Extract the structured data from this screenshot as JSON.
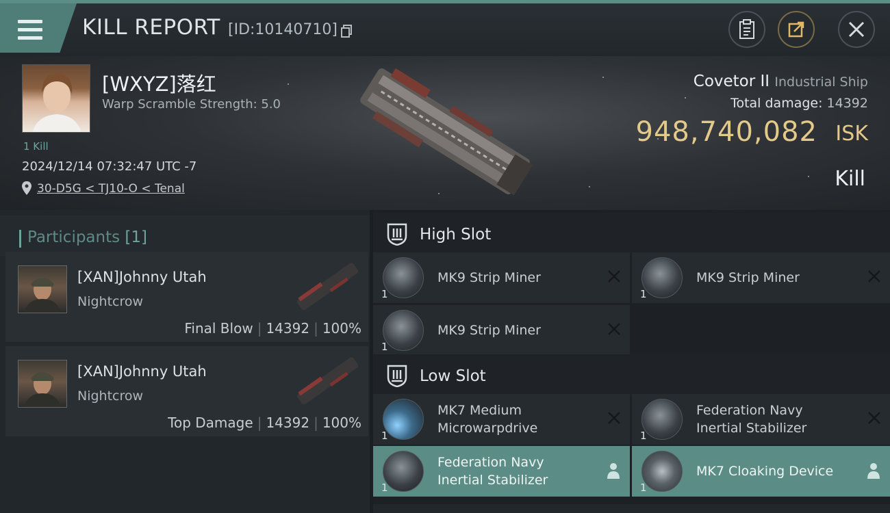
{
  "header": {
    "title": "KILL REPORT",
    "report_id": "[ID:10140710]",
    "icons": [
      "menu-icon",
      "copy-icon",
      "clipboard-icon",
      "export-icon",
      "close-icon"
    ]
  },
  "victim": {
    "name": "[WXYZ]落红",
    "warp_scramble": "Warp Scramble Strength: 5.0",
    "kills": "1 Kill",
    "timestamp": "2024/12/14 07:32:47 UTC -7",
    "location": "30-D5G < TJ10-O < Tenal"
  },
  "ship": {
    "name": "Covetor II",
    "class": "Industrial Ship",
    "total_damage_label": "Total damage:",
    "total_damage_value": "14392",
    "isk_value": "948,740,082",
    "isk_unit": "ISK",
    "result": "Kill"
  },
  "participants": {
    "title": "Participants",
    "count": "[1]",
    "rows": [
      {
        "name": "[XAN]Johnny Utah",
        "ship": "Nightcrow",
        "role": "Final Blow",
        "damage": "14392",
        "percent": "100%"
      },
      {
        "name": "[XAN]Johnny Utah",
        "ship": "Nightcrow",
        "role": "Top Damage",
        "damage": "14392",
        "percent": "100%"
      }
    ]
  },
  "fitting": {
    "high_slot": {
      "title": "High Slot",
      "modules": [
        {
          "name": "MK9 Strip Miner",
          "qty": "1",
          "state": "destroyed"
        },
        {
          "name": "MK9 Strip Miner",
          "qty": "1",
          "state": "destroyed"
        },
        {
          "name": "MK9 Strip Miner",
          "qty": "1",
          "state": "destroyed"
        }
      ]
    },
    "low_slot": {
      "title": "Low Slot",
      "modules": [
        {
          "name_line1": "MK7 Medium",
          "name_line2": "Microwarpdrive",
          "qty": "1",
          "state": "destroyed"
        },
        {
          "name_line1": "Federation Navy",
          "name_line2": "Inertial Stabilizer",
          "qty": "1",
          "state": "destroyed"
        },
        {
          "name_line1": "Federation Navy",
          "name_line2": "Inertial Stabilizer",
          "qty": "1",
          "state": "dropped"
        },
        {
          "name": "MK7 Cloaking Device",
          "qty": "1",
          "state": "dropped"
        }
      ]
    }
  },
  "colors": {
    "accent": "#5b8d86",
    "isk_gold": "#e3c98a",
    "background": "#1b1f23"
  }
}
